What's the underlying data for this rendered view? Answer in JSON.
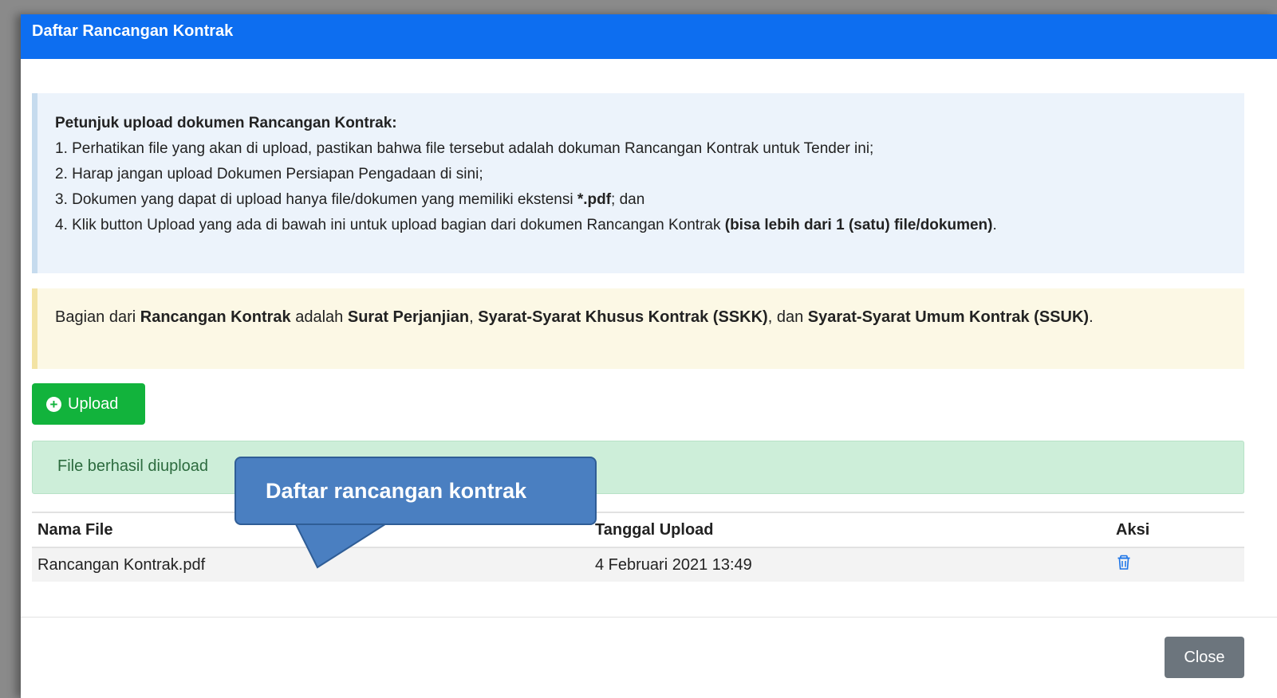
{
  "modal": {
    "title": "Daftar Rancangan Kontrak"
  },
  "instructions": {
    "title": "Petunjuk upload dokumen Rancangan Kontrak:",
    "line1": "1. Perhatikan file yang akan di upload, pastikan bahwa file tersebut adalah dokuman Rancangan Kontrak untuk Tender ini;",
    "line2": "2. Harap jangan upload Dokumen Persiapan Pengadaan di sini;",
    "line3_pre": "3. Dokumen yang dapat di upload hanya file/dokumen yang memiliki ekstensi ",
    "line3_bold": "*.pdf",
    "line3_post": "; dan",
    "line4_pre": "4. Klik button Upload yang ada di bawah ini untuk upload bagian dari dokumen Rancangan Kontrak ",
    "line4_bold": "(bisa lebih dari 1 (satu) file/dokumen)",
    "line4_post": "."
  },
  "note": {
    "part1": "Bagian dari ",
    "part2": "Rancangan Kontrak",
    "part3": " adalah ",
    "part4": "Surat Perjanjian",
    "part5": ", ",
    "part6": "Syarat-Syarat Khusus Kontrak (SSKK)",
    "part7": ", dan ",
    "part8": "Syarat-Syarat Umum Kontrak (SSUK)",
    "part9": "."
  },
  "upload_button": {
    "label": "Upload",
    "icon": "plus-circle-icon",
    "color": "#12b33c"
  },
  "success_message": "File berhasil diupload",
  "table": {
    "headers": {
      "name": "Nama File",
      "date": "Tanggal Upload",
      "action": "Aksi"
    },
    "rows": [
      {
        "name": "Rancangan Kontrak.pdf",
        "date": "4 Februari 2021 13:49",
        "action_icon": "trash-icon"
      }
    ]
  },
  "close_button": {
    "label": "Close"
  },
  "callout": {
    "text": "Daftar rancangan kontrak"
  },
  "colors": {
    "header": "#0d6ef0",
    "info_bg": "#ecf3fb",
    "note_bg": "#fcf8e5",
    "success_bg": "#cdeed9",
    "close_bg": "#6c757d",
    "callout_bg": "#4a7fc1",
    "icon_blue": "#1a73e8"
  }
}
